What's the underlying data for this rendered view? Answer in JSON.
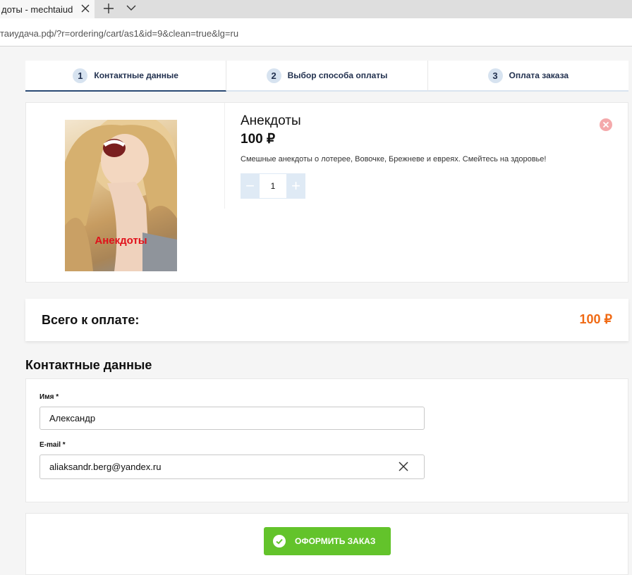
{
  "browser": {
    "tab_title": "доты - mechtaiudac",
    "url": "таиудача.рф/?r=ordering/cart/as1&id=9&clean=true&lg=ru"
  },
  "steps": [
    {
      "num": "1",
      "label": "Контактные данные",
      "active": true
    },
    {
      "num": "2",
      "label": "Выбор способа оплаты",
      "active": false
    },
    {
      "num": "3",
      "label": "Оплата заказа",
      "active": false
    }
  ],
  "product": {
    "title": "Анекдоты",
    "price": "100 ₽",
    "description": "Смешные анекдоты о лотерее, Вовочке, Брежневе и евреях. Смейтесь на здоровье!",
    "image_caption": "Анекдоты",
    "quantity": "1",
    "minus": "−",
    "plus": "+"
  },
  "total": {
    "label": "Всего к оплате:",
    "value": "100 ₽"
  },
  "contact": {
    "title": "Контактные данные",
    "name_label": "Имя *",
    "name_value": "Александр",
    "email_label": "E-mail *",
    "email_value": "aliaksandr.berg@yandex.ru"
  },
  "submit": {
    "label": "ОФОРМИТЬ ЗАКАЗ"
  },
  "colors": {
    "accent_orange": "#f06a14",
    "submit_green": "#63c32b",
    "step_active": "#2b4a75",
    "remove_red": "#f4a9ab"
  }
}
